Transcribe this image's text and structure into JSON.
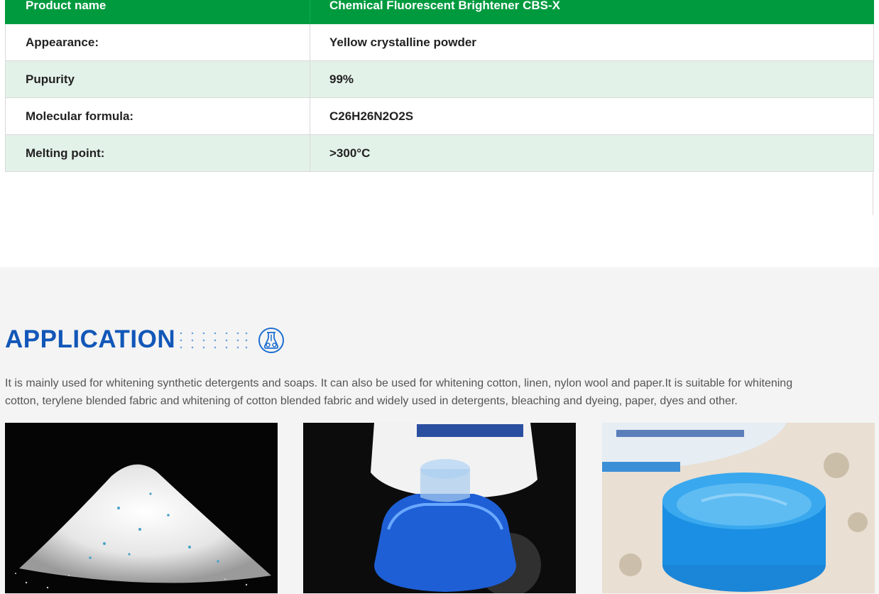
{
  "spec_table": {
    "header": {
      "label": "Product name",
      "value": "Chemical Fluorescent Brightener CBS-X"
    },
    "rows": [
      {
        "label": "Appearance:",
        "value": "Yellow crystalline powder"
      },
      {
        "label": "Pupurity",
        "value": "99%"
      },
      {
        "label": "Molecular formula:",
        "value": "C26H26N2O2S"
      },
      {
        "label": "Melting point:",
        "value": ">300°C"
      }
    ]
  },
  "application": {
    "title": "APPLICATION",
    "icon": "flask-icon",
    "description": "It is mainly used for whitening synthetic detergents and soaps. It can also be used for whitening cotton, linen, nylon wool and paper.It is suitable for whitening cotton, terylene blended fabric and  whitening of cotton blended fabric and widely used in detergents, bleaching and dyeing, paper, dyes and other.",
    "images": [
      {
        "name": "detergent-powder-image"
      },
      {
        "name": "blue-bottle-cap-image"
      },
      {
        "name": "blue-paste-jar-image"
      }
    ]
  },
  "colors": {
    "header_green": "#009a3e",
    "row_alt": "#e3f2e8",
    "title_blue": "#1257b8",
    "section_bg": "#f4f4f4"
  }
}
